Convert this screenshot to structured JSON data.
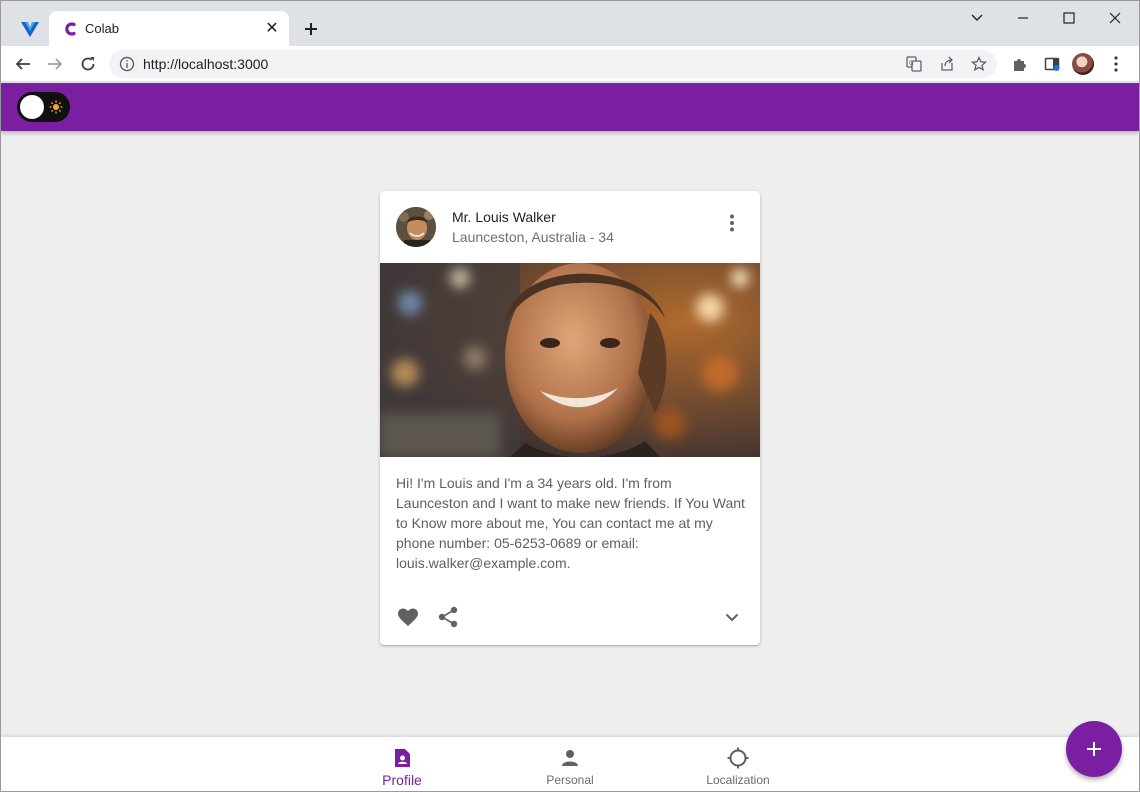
{
  "browser": {
    "tab_title": "Colab",
    "url": "http://localhost:3000",
    "icons": {
      "extension_logo": "v-logo-icon",
      "favicon": "colab-c-icon",
      "close": "close-icon",
      "new_tab": "plus-icon",
      "tab_search": "chevron-down-icon",
      "minimize": "minimize-icon",
      "maximize": "maximize-icon",
      "close_window": "close-window-icon",
      "back": "back-arrow-icon",
      "forward": "forward-arrow-icon",
      "reload": "reload-icon",
      "site_info": "info-icon",
      "translate": "translate-icon",
      "share": "share-icon",
      "bookmark": "star-icon",
      "extensions": "puzzle-icon",
      "side_panel": "side-panel-icon",
      "profile": "profile-avatar",
      "menu": "kebab-menu-icon"
    }
  },
  "app": {
    "accent_color": "#7b1fa2",
    "theme_toggle": {
      "state": "light",
      "icon": "sun-icon"
    },
    "card": {
      "name": "Mr. Louis Walker",
      "subtitle": "Launceston, Australia - 34",
      "description": "Hi! I'm Louis and I'm a 34 years old. I'm from Launceston and I want to make new friends. If You Want to Know more about me, You can contact me at my phone number: 05-6253-0689 or email: louis.walker@example.com.",
      "actions": {
        "like": "heart-icon",
        "share": "share-icon",
        "expand": "chevron-down-icon",
        "menu": "more-vert-icon"
      }
    },
    "bottom_nav": {
      "items": [
        {
          "label": "Profile",
          "icon": "profile-badge-icon",
          "active": true
        },
        {
          "label": "Personal",
          "icon": "person-icon",
          "active": false
        },
        {
          "label": "Localization",
          "icon": "crosshair-icon",
          "active": false
        }
      ]
    },
    "fab": {
      "icon": "plus-icon"
    }
  }
}
